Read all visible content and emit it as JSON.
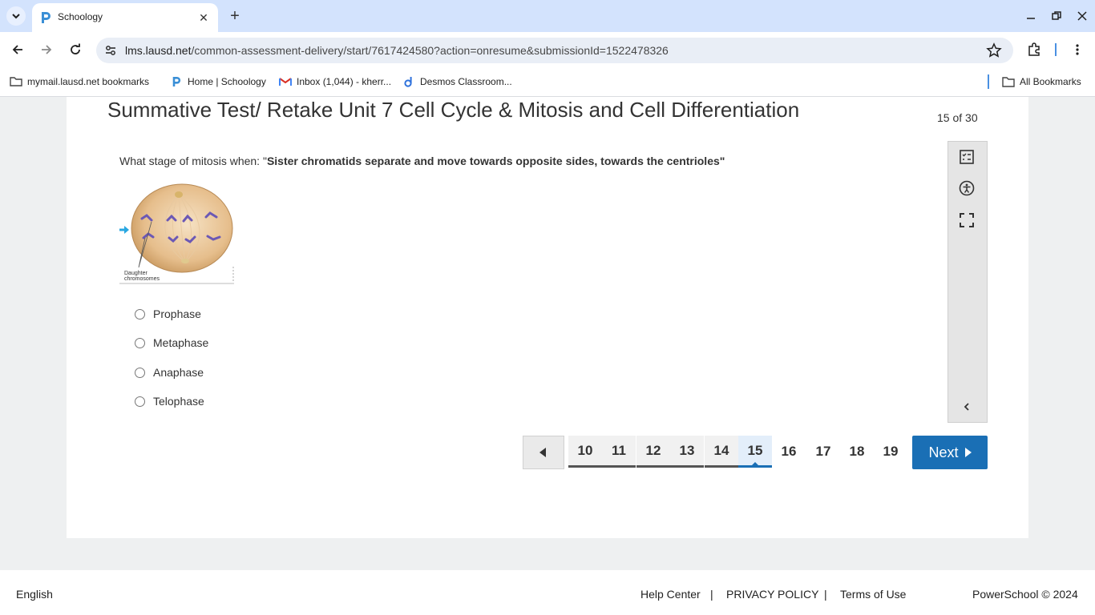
{
  "browser": {
    "tab_title": "Schoology",
    "url_host": "lms.lausd.net",
    "url_path": "/common-assessment-delivery/start/7617424580?action=onresume&submissionId=1522478326",
    "bookmarks": [
      {
        "label": "mymail.lausd.net bookmarks",
        "icon": "bookmark-manager-icon"
      },
      {
        "label": "Home | Schoology",
        "icon": "schoology-icon"
      },
      {
        "label": "Inbox (1,044) - kherr...",
        "icon": "gmail-icon"
      },
      {
        "label": "Desmos Classroom...",
        "icon": "desmos-icon"
      }
    ],
    "all_bookmarks": "All Bookmarks"
  },
  "test": {
    "title": "Summative Test/ Retake Unit 7 Cell Cycle & Mitosis and Cell Differentiation",
    "counter": "15 of 30",
    "question_prefix": "What stage of mitosis when: \"",
    "question_bold": "Sister chromatids separate and move towards opposite sides, towards the centrioles\"",
    "figure_label_line1": "Daughter",
    "figure_label_line2": "chromosomes",
    "choices": [
      "Prophase",
      "Metaphase",
      "Anaphase",
      "Telophase"
    ]
  },
  "pagination": {
    "pages": [
      "10",
      "11",
      "12",
      "13",
      "14",
      "15",
      "16",
      "17",
      "18",
      "19"
    ],
    "current": "15",
    "next_label": "Next"
  },
  "footer": {
    "language": "English",
    "help": "Help Center",
    "sep1": "|",
    "privacy": "PRIVACY POLICY",
    "sep2": "|",
    "terms": "Terms of Use",
    "copyright": "PowerSchool © 2024"
  },
  "colors": {
    "accent": "#1a6fb5",
    "tab_strip": "#d3e3fd"
  }
}
